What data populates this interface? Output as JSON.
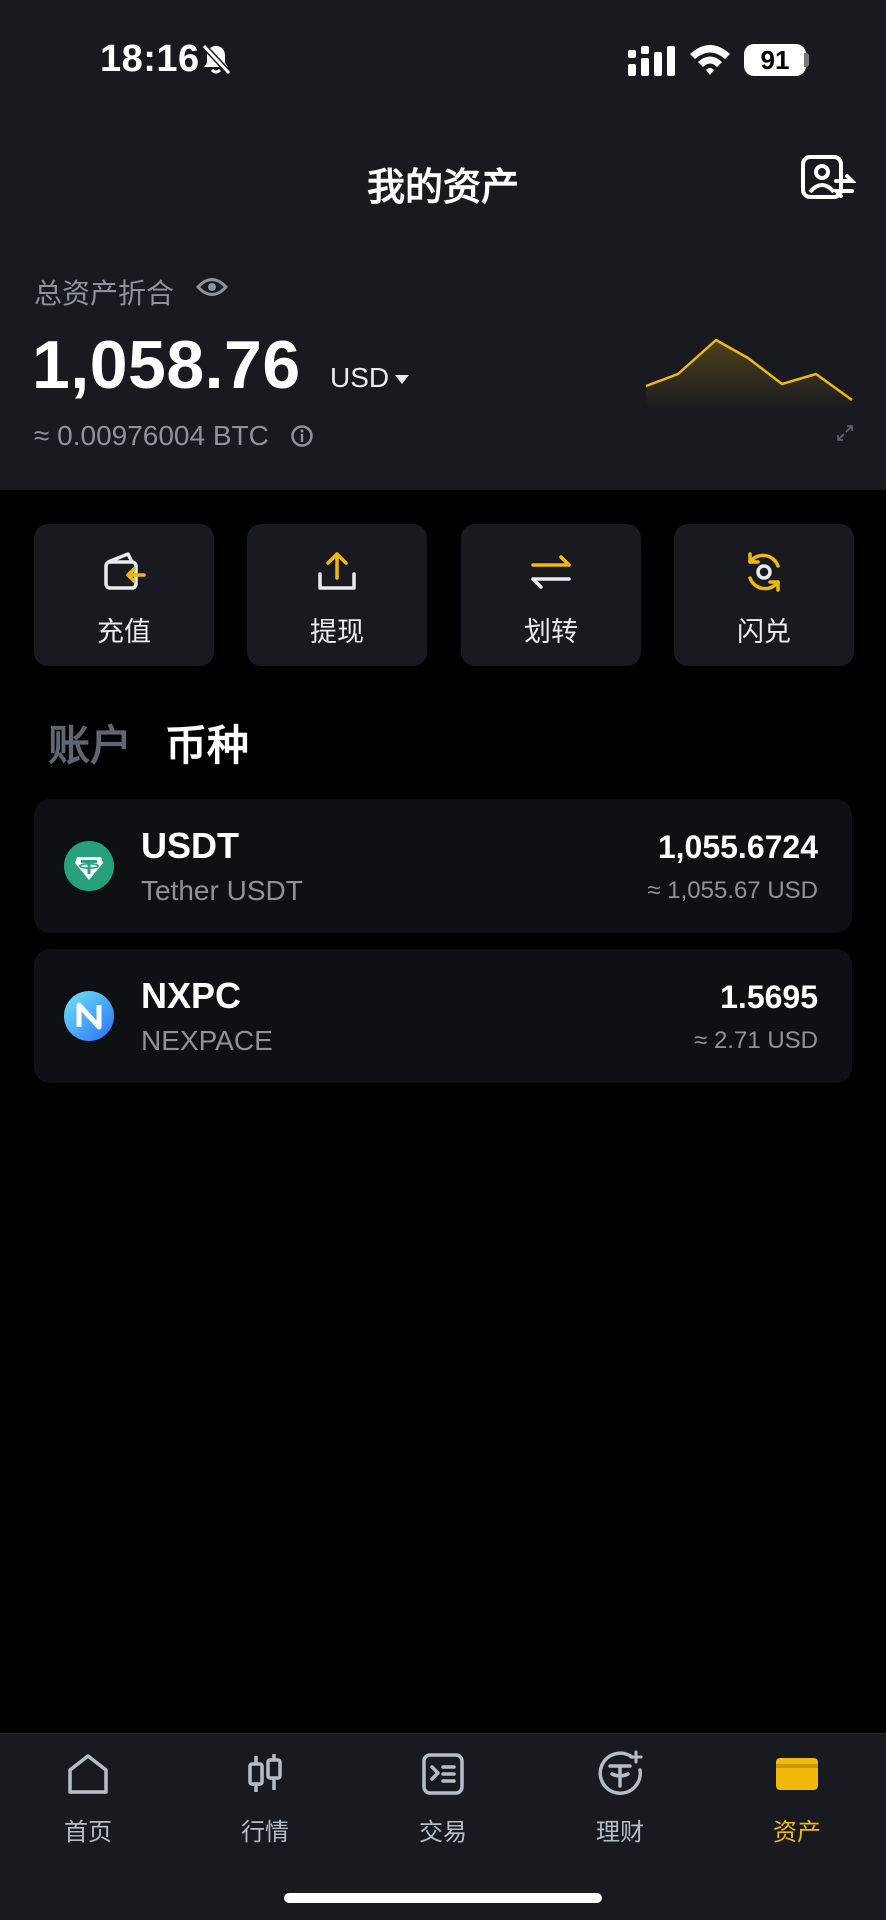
{
  "status_bar": {
    "time": "18:16",
    "battery": "91"
  },
  "header": {
    "title": "我的资产"
  },
  "summary": {
    "label": "总资产折合",
    "total": "1,058.76",
    "currency": "USD",
    "btc_equivalent": "≈ 0.00976004 BTC"
  },
  "actions": [
    {
      "label": "充值",
      "icon": "deposit-icon"
    },
    {
      "label": "提现",
      "icon": "withdraw-icon"
    },
    {
      "label": "划转",
      "icon": "transfer-icon"
    },
    {
      "label": "闪兑",
      "icon": "convert-icon"
    }
  ],
  "tabs": [
    {
      "label": "账户",
      "active": false
    },
    {
      "label": "币种",
      "active": true
    }
  ],
  "assets": [
    {
      "symbol": "USDT",
      "name": "Tether USDT",
      "amount": "1,055.6724",
      "usd_value": "≈ 1,055.67 USD",
      "icon": "tether-logo-icon"
    },
    {
      "symbol": "NXPC",
      "name": "NEXPACE",
      "amount": "1.5695",
      "usd_value": "≈ 2.71 USD",
      "icon": "nexpace-logo-icon"
    }
  ],
  "bottom_nav": [
    {
      "label": "首页",
      "icon": "home-icon",
      "active": false
    },
    {
      "label": "行情",
      "icon": "candlestick-icon",
      "active": false
    },
    {
      "label": "交易",
      "icon": "trade-icon",
      "active": false
    },
    {
      "label": "理财",
      "icon": "earn-icon",
      "active": false
    },
    {
      "label": "资产",
      "icon": "wallet-icon",
      "active": true
    }
  ],
  "colors": {
    "accent": "#f0b90b",
    "background": "#000000",
    "panel": "#181a20",
    "muted_text": "#8d929b"
  }
}
